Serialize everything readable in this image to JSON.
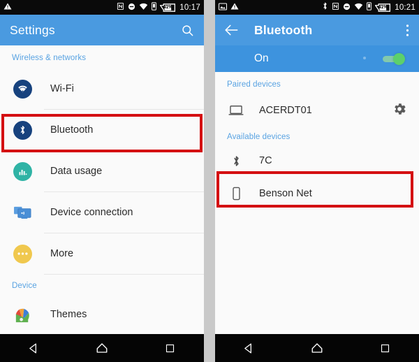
{
  "left_phone": {
    "status_bar": {
      "time": "10:17",
      "battery_percent": "41%",
      "icons": [
        "warning-triangle-icon",
        "nfc-icon",
        "do-not-disturb-icon",
        "wifi-icon",
        "sim-card-icon",
        "battery-icon"
      ]
    },
    "app_bar": {
      "title": "Settings",
      "action_icon": "search-icon",
      "background_color": "#4a9ae0"
    },
    "sections": [
      {
        "header": "Wireless & networks",
        "items": [
          {
            "label": "Wi-Fi",
            "icon": "wifi-icon",
            "icon_color": "#17427e"
          },
          {
            "label": "Bluetooth",
            "icon": "bluetooth-icon",
            "icon_color": "#17427e",
            "highlighted": true
          },
          {
            "label": "Data usage",
            "icon": "data-usage-icon",
            "icon_color": "#2fb3a5"
          },
          {
            "label": "Device connection",
            "icon": "device-connection-icon",
            "icon_color": "#4a8fd6"
          },
          {
            "label": "More",
            "icon": "more-dots-icon",
            "icon_color": "#f0c84e"
          }
        ]
      },
      {
        "header": "Device",
        "items": [
          {
            "label": "Themes",
            "icon": "themes-palette-icon",
            "icon_color": "#e24a3a"
          }
        ]
      }
    ],
    "nav_bar": {
      "back": "back-triangle-icon",
      "home": "home-icon",
      "recents": "recents-square-icon"
    }
  },
  "right_phone": {
    "status_bar": {
      "time": "10:21",
      "battery_percent": "41%",
      "icons": [
        "screenshot-icon",
        "warning-triangle-icon",
        "bluetooth-icon",
        "nfc-icon",
        "do-not-disturb-icon",
        "wifi-icon",
        "sim-card-icon",
        "battery-icon"
      ]
    },
    "app_bar": {
      "back_icon": "arrow-back-icon",
      "title": "Bluetooth",
      "overflow_icon": "overflow-menu-icon",
      "background_color": "#4a9ae0"
    },
    "toggle": {
      "label": "On",
      "state": "on",
      "knob_color": "#5cd06c",
      "background_color": "#3d93de"
    },
    "sections": [
      {
        "header": "Paired devices",
        "devices": [
          {
            "name": "ACERDT01",
            "icon": "laptop-icon",
            "trailing_icon": "settings-gear-icon"
          }
        ]
      },
      {
        "header": "Available devices",
        "devices": [
          {
            "name": "7C",
            "icon": "bluetooth-icon"
          },
          {
            "name": "Benson Net",
            "icon": "phone-icon",
            "highlighted": true
          }
        ]
      }
    ],
    "nav_bar": {
      "back": "back-triangle-icon",
      "home": "home-icon",
      "recents": "recents-square-icon"
    }
  },
  "annotations": {
    "highlight_color": "#d40f12",
    "boxes": [
      "bluetooth-row-highlight",
      "benson-net-row-highlight"
    ]
  }
}
